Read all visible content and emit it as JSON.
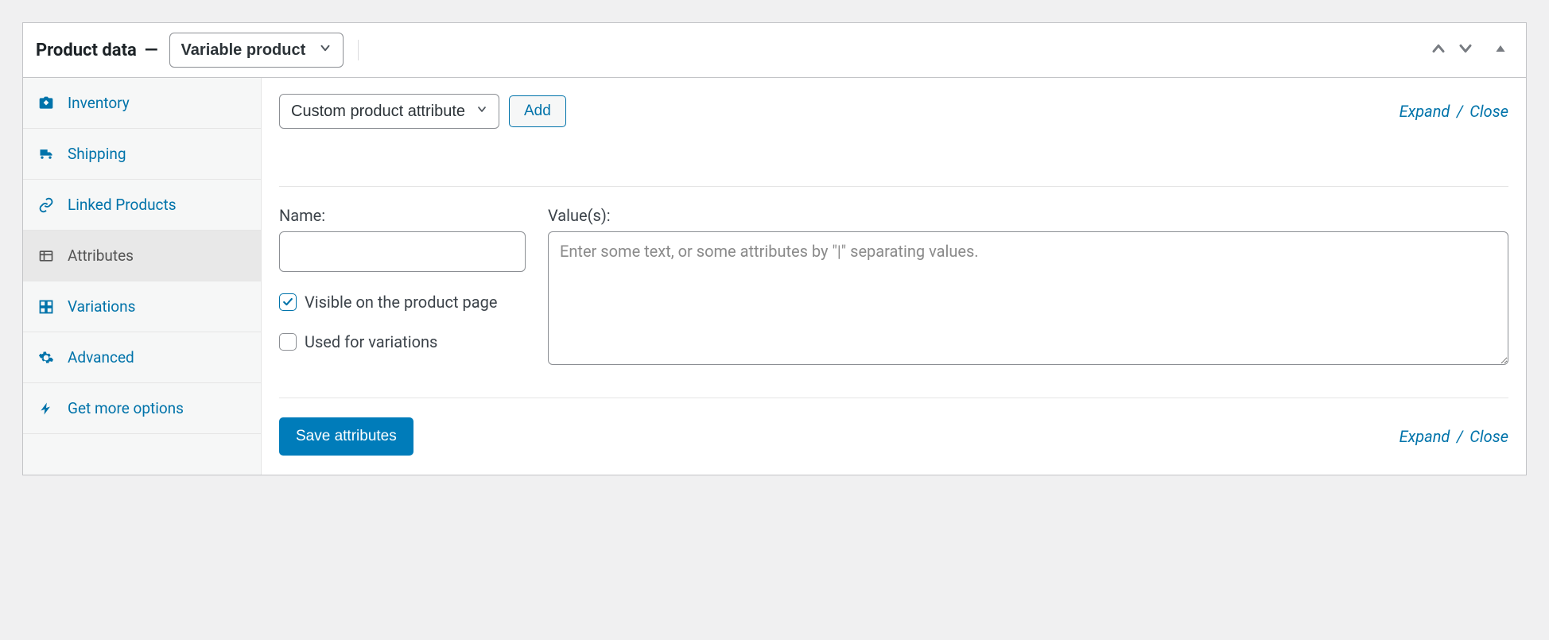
{
  "header": {
    "title": "Product data",
    "separator": "—",
    "product_type": "Variable product"
  },
  "sidebar": {
    "items": [
      {
        "label": "Inventory",
        "icon": "inventory-icon"
      },
      {
        "label": "Shipping",
        "icon": "shipping-icon"
      },
      {
        "label": "Linked Products",
        "icon": "linked-products-icon"
      },
      {
        "label": "Attributes",
        "icon": "attributes-icon"
      },
      {
        "label": "Variations",
        "icon": "variations-icon"
      },
      {
        "label": "Advanced",
        "icon": "advanced-icon"
      },
      {
        "label": "Get more options",
        "icon": "more-options-icon"
      }
    ],
    "active_index": 3
  },
  "toolbar": {
    "attribute_select": "Custom product attribute",
    "add_button": "Add",
    "expand": "Expand",
    "close": "Close"
  },
  "attribute_form": {
    "name_label": "Name:",
    "name_value": "",
    "values_label": "Value(s):",
    "values_placeholder": "Enter some text, or some attributes by \"|\" separating values.",
    "values_value": "",
    "visible_label": "Visible on the product page",
    "visible_checked": true,
    "variations_label": "Used for variations",
    "variations_checked": false
  },
  "footer": {
    "save_button": "Save attributes",
    "expand": "Expand",
    "close": "Close"
  }
}
